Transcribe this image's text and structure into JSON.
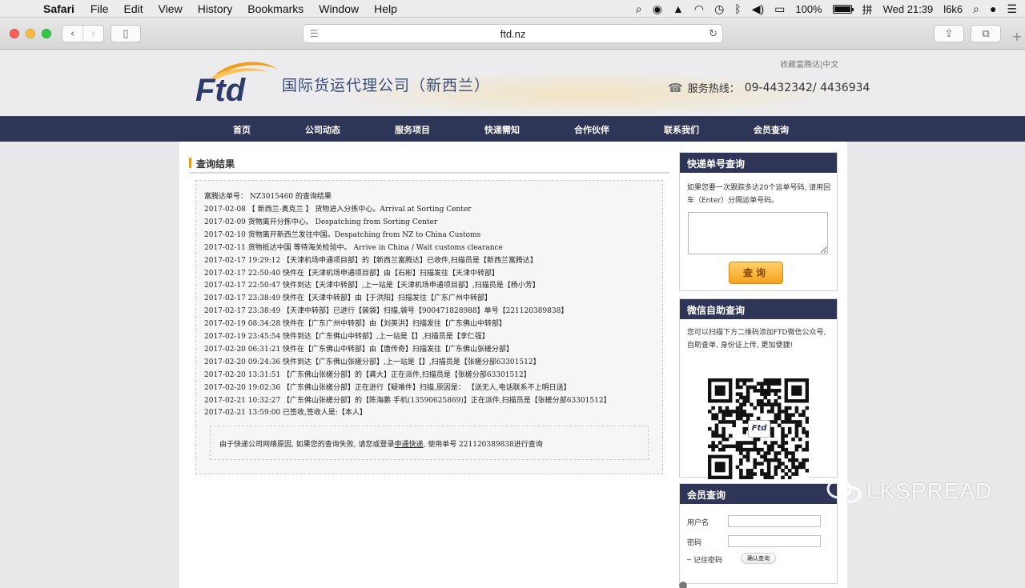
{
  "menubar": {
    "app": "Safari",
    "items": [
      "File",
      "Edit",
      "View",
      "History",
      "Bookmarks",
      "Window",
      "Help"
    ],
    "battery_percent": "100%",
    "battery_level": 1.0,
    "input_method": "拼",
    "clock": "Wed 21:39",
    "user": "l6k6"
  },
  "browser": {
    "url": "ftd.nz"
  },
  "header": {
    "logo_text": "国际货运代理公司（新西兰）",
    "logo_mark": "Ftd",
    "top_links": "收藏富腾达|中文",
    "hotline_label": "服务热线：",
    "hotline_number": "09-4432342/ 4436934"
  },
  "nav": [
    "首页",
    "公司动态",
    "服务项目",
    "快递需知",
    "合作伙伴",
    "联系我们",
    "会员查询"
  ],
  "result": {
    "section_title": "查询结果",
    "heading": "富腾达单号： NZ3015460 的查询结果",
    "lines": [
      "2017-02-08 【 新西兰-奥克兰 】 货物进入分拣中心。Arrival at Sorting Center",
      "2017-02-09 货物离开分拣中心。 Despatching from Sorting Center",
      "2017-02-10 货物离开新西兰发往中国。Despatching from NZ to China Customs",
      "2017-02-11 货物抵达中国 等待海关检验中。 Arrive in China / Wait customs clearance",
      "2017-02-17 19:29:12 【天津机场申通项目部】的【新西兰富腾达】已收件,扫描员是【新西兰富腾达】",
      "2017-02-17 22:50:40 快件在【天津机场申通项目部】由【石彬】扫描发往【天津中转部】",
      "2017-02-17 22:50:47 快件到达【天津中转部】,上一站是【天津机场申通项目部】,扫描员是【杨小芳】",
      "2017-02-17 23:38:49 快件在【天津中转部】由【于洪阳】扫描发往【广东广州中转部】",
      "2017-02-17 23:38:49 【天津中转部】已进行【装袋】扫描,袋号【900471828988】单号【221120389838】",
      "2017-02-19 08:34:28 快件在【广东广州中转部】由【刘英洪】扫描发往【广东佛山中转部】",
      "2017-02-19 23:45:54 快件到达【广东佛山中转部】,上一站是【】,扫描员是【李仁强】",
      "2017-02-20 06:31:21 快件在【广东佛山中转部】由【唐传奇】扫描发往【广东佛山张槎分部】",
      "2017-02-20 09:24:36 快件到达【广东佛山张槎分部】,上一站是【】,扫描员是【张槎分部63301512】",
      "2017-02-20 13:31:51 【广东佛山张槎分部】的【龚大】正在派件,扫描员是【张槎分部63301512】",
      "2017-02-20 19:02:36 【广东佛山张槎分部】正在进行【疑难件】扫描,原因是： 【送无人,电话联系不上明日送】",
      "2017-02-21 10:32:27 【广东佛山张槎分部】的【陈海鹏 手机(13590625869)】正在派件,扫描员是【张槎分部63301512】",
      "2017-02-21 13:59:00 已签收,签收人是:【本人】"
    ],
    "notice_before": "由于快递公司网络原因, 如果您的查询失败, 请您或登录",
    "notice_link": "申通快递",
    "notice_after": ", 使用单号 221120389838进行查询"
  },
  "sidebar": {
    "track": {
      "title": "快递单号查询",
      "desc": "如果您要一次跟踪多达20个运单号码, 请用回车（Enter）分隔运单号码。",
      "input_value": "",
      "button": "查询"
    },
    "wechat": {
      "title": "微信自助查询",
      "desc": "您可以扫描下方二维码添加FTD微信公众号, 自助查单, 身份证上传, 更加便捷!",
      "qr_logo": "Ftd"
    },
    "member": {
      "title": "会员查询",
      "username_label": "用户名",
      "password_label": "密码",
      "username_value": "",
      "password_value": "",
      "remember_label": "记住密码",
      "confirm_button": "确认查询"
    }
  },
  "watermark": "LKSPREAD",
  "colors": {
    "nav_bg": "#2e3557",
    "accent": "#e59a1c",
    "button_orange": "#f4a11c"
  }
}
